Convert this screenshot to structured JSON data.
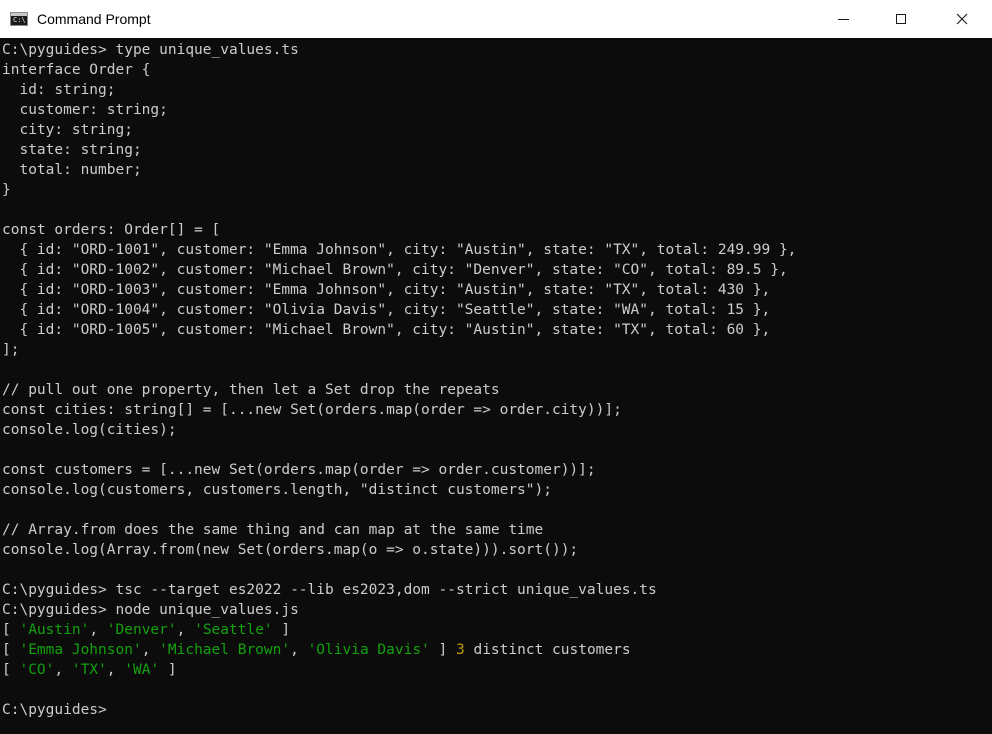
{
  "window": {
    "title": "Command Prompt",
    "icon": "cmd-icon",
    "icon_glyph": "C:\\",
    "controls": {
      "minimize": "minimize-icon",
      "maximize": "maximize-icon",
      "close": "close-icon"
    }
  },
  "colors": {
    "background": "#0c0c0c",
    "text": "#cccccc",
    "string_output": "#13a10e",
    "number_output": "#c19c00",
    "titlebar": "#ffffff"
  },
  "terminal": {
    "lines": [
      [
        {
          "t": "C:\\pyguides> type unique_values.ts"
        }
      ],
      [
        {
          "t": "interface Order {"
        }
      ],
      [
        {
          "t": "  id: string;"
        }
      ],
      [
        {
          "t": "  customer: string;"
        }
      ],
      [
        {
          "t": "  city: string;"
        }
      ],
      [
        {
          "t": "  state: string;"
        }
      ],
      [
        {
          "t": "  total: number;"
        }
      ],
      [
        {
          "t": "}"
        }
      ],
      [
        {
          "t": ""
        }
      ],
      [
        {
          "t": "const orders: Order[] = ["
        }
      ],
      [
        {
          "t": "  { id: \"ORD-1001\", customer: \"Emma Johnson\", city: \"Austin\", state: \"TX\", total: 249.99 },"
        }
      ],
      [
        {
          "t": "  { id: \"ORD-1002\", customer: \"Michael Brown\", city: \"Denver\", state: \"CO\", total: 89.5 },"
        }
      ],
      [
        {
          "t": "  { id: \"ORD-1003\", customer: \"Emma Johnson\", city: \"Austin\", state: \"TX\", total: 430 },"
        }
      ],
      [
        {
          "t": "  { id: \"ORD-1004\", customer: \"Olivia Davis\", city: \"Seattle\", state: \"WA\", total: 15 },"
        }
      ],
      [
        {
          "t": "  { id: \"ORD-1005\", customer: \"Michael Brown\", city: \"Austin\", state: \"TX\", total: 60 },"
        }
      ],
      [
        {
          "t": "];"
        }
      ],
      [
        {
          "t": ""
        }
      ],
      [
        {
          "t": "// pull out one property, then let a Set drop the repeats"
        }
      ],
      [
        {
          "t": "const cities: string[] = [...new Set(orders.map(order => order.city))];"
        }
      ],
      [
        {
          "t": "console.log(cities);"
        }
      ],
      [
        {
          "t": ""
        }
      ],
      [
        {
          "t": "const customers = [...new Set(orders.map(order => order.customer))];"
        }
      ],
      [
        {
          "t": "console.log(customers, customers.length, \"distinct customers\");"
        }
      ],
      [
        {
          "t": ""
        }
      ],
      [
        {
          "t": "// Array.from does the same thing and can map at the same time"
        }
      ],
      [
        {
          "t": "console.log(Array.from(new Set(orders.map(o => o.state))).sort());"
        }
      ],
      [
        {
          "t": ""
        }
      ],
      [
        {
          "t": "C:\\pyguides> tsc --target es2022 --lib es2023,dom --strict unique_values.ts"
        }
      ],
      [
        {
          "t": "C:\\pyguides> node unique_values.js"
        }
      ],
      [
        {
          "t": "[ "
        },
        {
          "t": "'Austin'",
          "c": "str"
        },
        {
          "t": ", "
        },
        {
          "t": "'Denver'",
          "c": "str"
        },
        {
          "t": ", "
        },
        {
          "t": "'Seattle'",
          "c": "str"
        },
        {
          "t": " ]"
        }
      ],
      [
        {
          "t": "[ "
        },
        {
          "t": "'Emma Johnson'",
          "c": "str"
        },
        {
          "t": ", "
        },
        {
          "t": "'Michael Brown'",
          "c": "str"
        },
        {
          "t": ", "
        },
        {
          "t": "'Olivia Davis'",
          "c": "str"
        },
        {
          "t": " ] "
        },
        {
          "t": "3",
          "c": "num"
        },
        {
          "t": " distinct customers"
        }
      ],
      [
        {
          "t": "[ "
        },
        {
          "t": "'CO'",
          "c": "str"
        },
        {
          "t": ", "
        },
        {
          "t": "'TX'",
          "c": "str"
        },
        {
          "t": ", "
        },
        {
          "t": "'WA'",
          "c": "str"
        },
        {
          "t": " ]"
        }
      ],
      [
        {
          "t": ""
        }
      ],
      [
        {
          "t": "C:\\pyguides>"
        }
      ]
    ]
  }
}
